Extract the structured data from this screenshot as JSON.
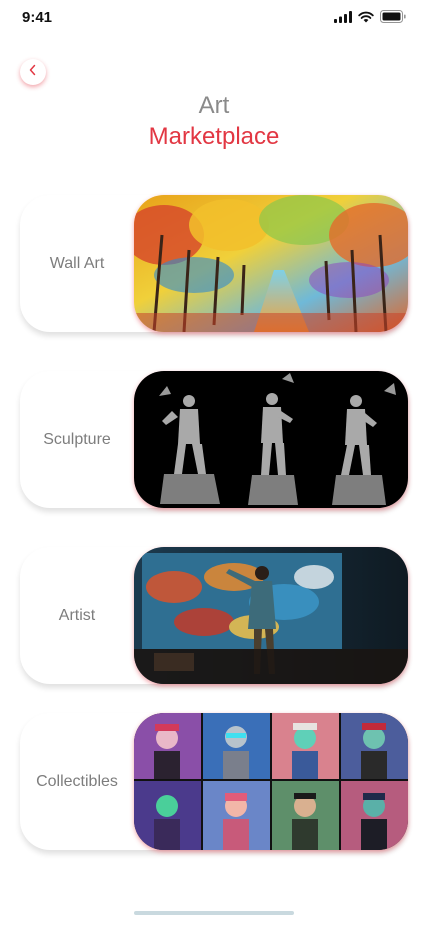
{
  "status_bar": {
    "time": "9:41"
  },
  "header": {
    "title_line1": "Art",
    "title_line2": "Marketplace"
  },
  "categories": [
    {
      "label": "Wall Art",
      "image": "painted-autumn-forest-path"
    },
    {
      "label": "Sculpture",
      "image": "statue-man-with-birds"
    },
    {
      "label": "Artist",
      "image": "painter-at-large-canvas"
    },
    {
      "label": "Collectibles",
      "image": "pixel-character-grid"
    }
  ],
  "colors": {
    "accent": "#e23743",
    "muted_text": "#8a8a8a",
    "indicator": "#c9d9df"
  },
  "icons": {
    "back": "chevron-left-icon",
    "signal": "signal-icon",
    "wifi": "wifi-icon",
    "battery": "battery-icon"
  }
}
